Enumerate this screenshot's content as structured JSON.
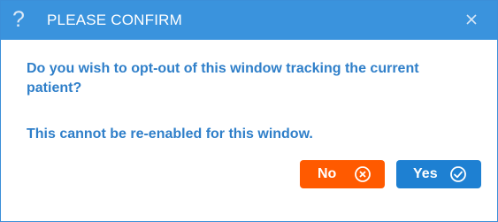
{
  "dialog": {
    "title": "PLEASE CONFIRM",
    "help_icon_glyph": "?",
    "help_icon": "question-mark-icon",
    "close_icon": "close-x-icon",
    "message_line": "Do you wish to opt-out of this window tracking the current patient?",
    "warning_line": "This cannot be re-enabled for this window."
  },
  "buttons": {
    "no": {
      "label": "No",
      "icon": "circle-x-icon",
      "color": "#ff5a00"
    },
    "yes": {
      "label": "Yes",
      "icon": "circle-check-icon",
      "color": "#1e80d2"
    }
  },
  "colors": {
    "title_bar": "#3a93dd",
    "message_text": "#2f7fc9"
  }
}
